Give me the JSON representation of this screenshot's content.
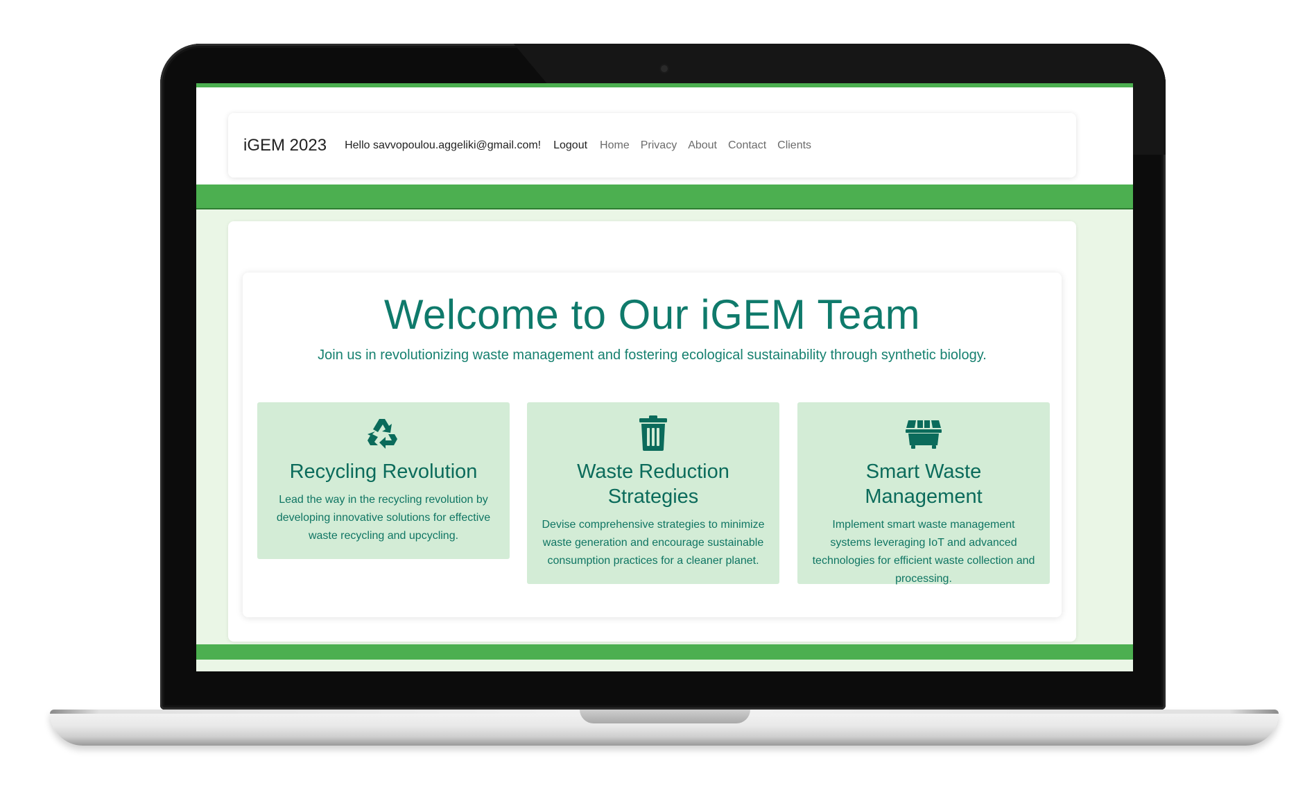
{
  "navbar": {
    "brand": "iGEM 2023",
    "greeting": "Hello savvopoulou.aggeliki@gmail.com!",
    "logout_label": "Logout",
    "links": [
      "Home",
      "Privacy",
      "About",
      "Contact",
      "Clients"
    ]
  },
  "hero": {
    "title": "Welcome to Our iGEM Team",
    "subtitle": "Join us in revolutionizing waste management and fostering ecological sustainability through synthetic biology."
  },
  "features": [
    {
      "icon": "recycle-icon",
      "title": "Recycling Revolution",
      "text": "Lead the way in the recycling revolution by developing innovative solutions for effective waste recycling and upcycling."
    },
    {
      "icon": "trash-icon",
      "title": "Waste Reduction Strategies",
      "text": "Devise comprehensive strategies to minimize waste generation and encourage sustainable consumption practices for a cleaner planet."
    },
    {
      "icon": "dumpster-icon",
      "title": "Smart Waste Management",
      "text": "Implement smart waste management systems leveraging IoT and advanced technologies for efficient waste collection and processing."
    }
  ],
  "colors": {
    "accent_green": "#4caf50",
    "teal_text": "#0f7a6b",
    "card_green": "#d3ecd6",
    "page_bg": "#eaf6e6"
  }
}
